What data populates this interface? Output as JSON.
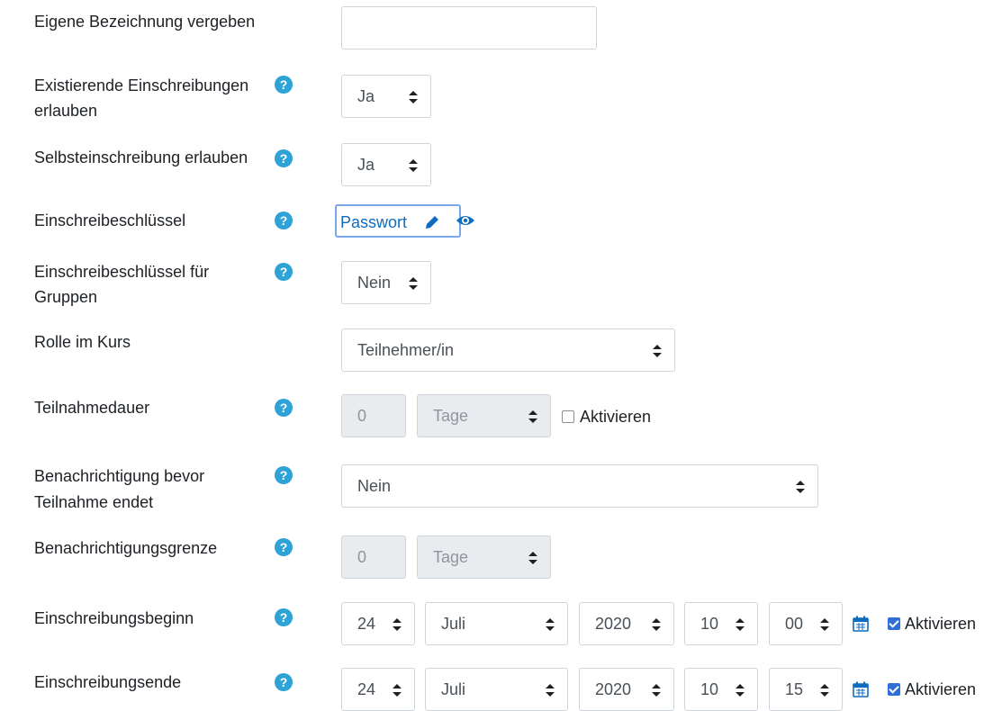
{
  "rows": {
    "name": {
      "label": "Eigene Bezeichnung vergeben",
      "value": ""
    },
    "existing": {
      "label": "Existierende Einschreibungen erlauben",
      "label_l1": "Existierende Einschreibungen",
      "label_l2": "erlauben",
      "value": "Ja"
    },
    "self": {
      "label": "Selbsteinschreibung erlauben",
      "value": "Ja"
    },
    "key": {
      "label": "Einschreibeschlüssel",
      "value": "Passwort"
    },
    "groupkey": {
      "label_l1": "Einschreibeschlüssel für",
      "label_l2": "Gruppen",
      "value": "Nein"
    },
    "role": {
      "label": "Rolle im Kurs",
      "value": "Teilnehmer/in"
    },
    "duration": {
      "label": "Teilnahmedauer",
      "number": "0",
      "unit": "Tage",
      "enable": "Aktivieren",
      "enabled": false
    },
    "notify": {
      "label_l1": "Benachrichtigung bevor",
      "label_l2": "Teilnahme endet",
      "value": "Nein"
    },
    "threshold": {
      "label": "Benachrichtigungsgrenze",
      "number": "0",
      "unit": "Tage"
    },
    "start": {
      "label": "Einschreibungsbeginn",
      "day": "24",
      "month": "Juli",
      "year": "2020",
      "hour": "10",
      "minute": "00",
      "enable": "Aktivieren",
      "enabled": true
    },
    "end": {
      "label": "Einschreibungsende",
      "day": "24",
      "month": "Juli",
      "year": "2020",
      "hour": "10",
      "minute": "15",
      "enable": "Aktivieren",
      "enabled": true
    }
  },
  "icons": {
    "help": "question-circle-icon",
    "edit": "pencil-icon",
    "reveal": "eye-icon",
    "calendar": "calendar-icon",
    "select": "sort-arrows-icon"
  },
  "help_glyph": "?",
  "colors": {
    "accent": "#0f6cbf",
    "help": "#2ea3d7",
    "checkbox": "#2f6fd6",
    "focus": "#7aa7e8"
  }
}
